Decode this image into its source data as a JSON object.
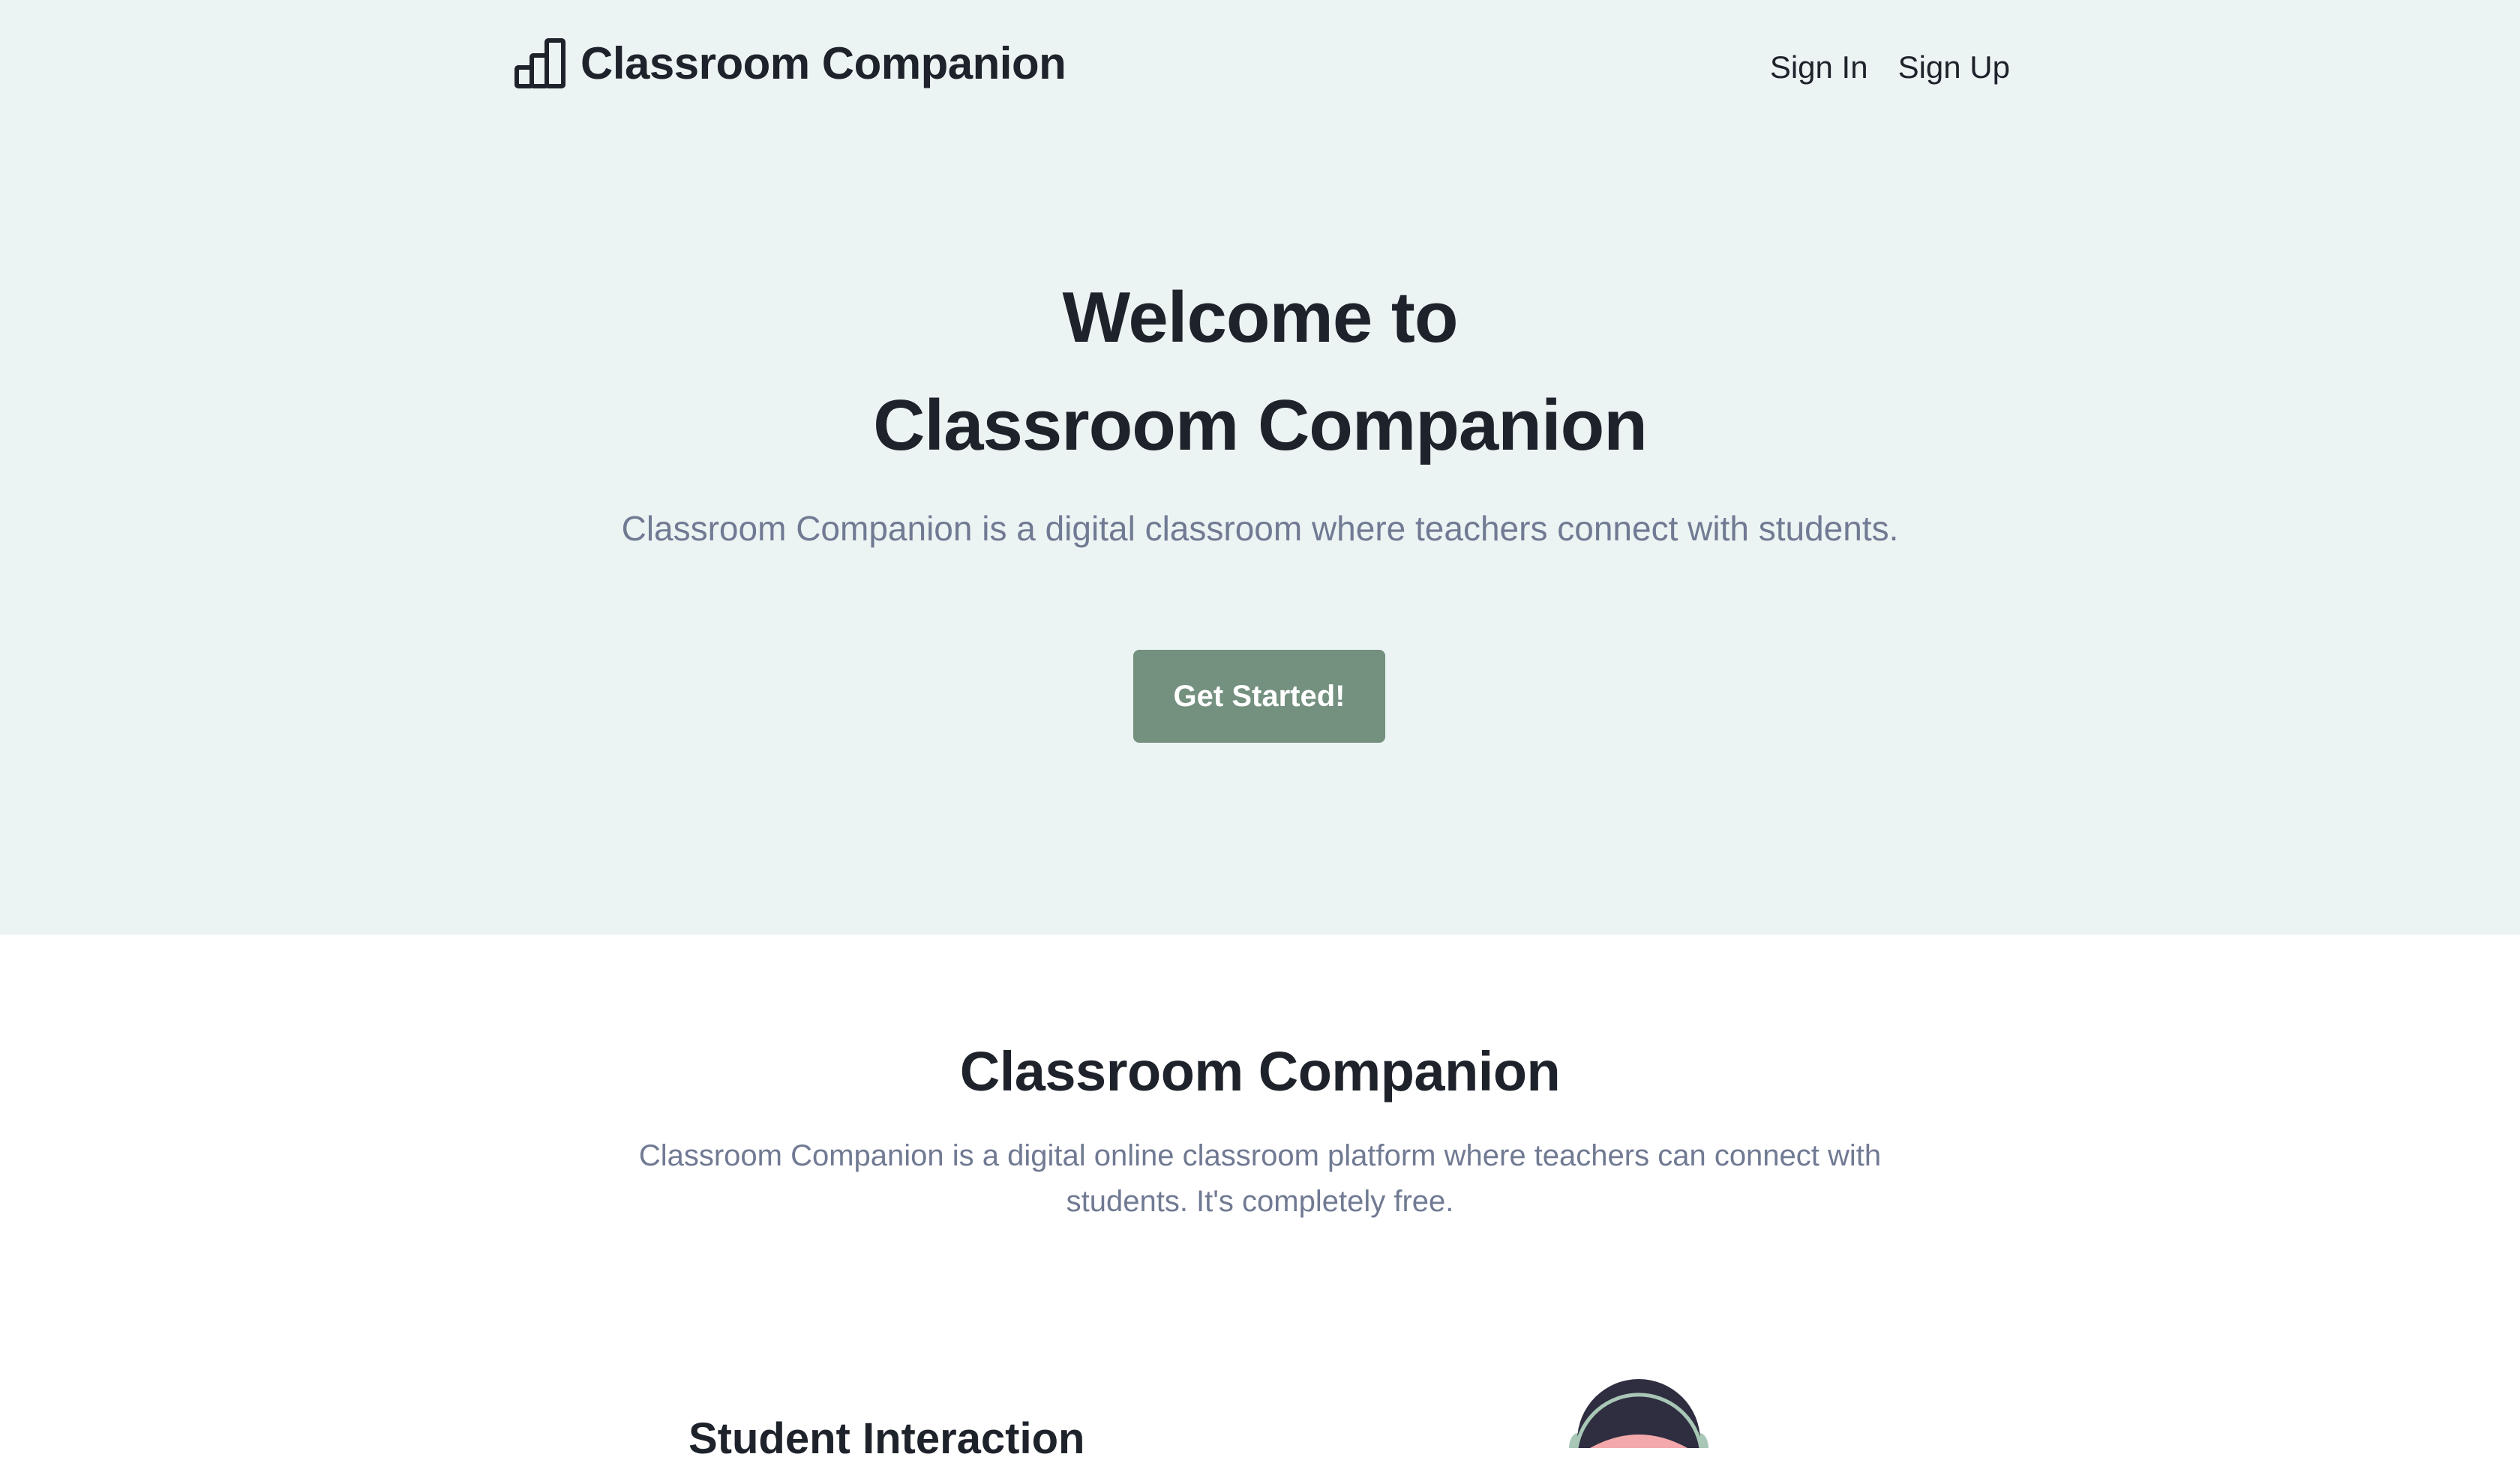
{
  "header": {
    "brand_name": "Classroom Companion",
    "brand_icon": "bar-chart-icon",
    "nav": [
      {
        "label": "Sign In"
      },
      {
        "label": "Sign Up"
      }
    ]
  },
  "hero": {
    "title_line1": "Welcome to",
    "title_line2": "Classroom Companion",
    "subtitle": "Classroom Companion is a digital classroom where teachers connect with students.",
    "cta_label": "Get Started!"
  },
  "about": {
    "title": "Classroom Companion",
    "description": "Classroom Companion is a digital online classroom platform where teachers can connect with students. It's completely free."
  },
  "feature": {
    "title": "Student Interaction",
    "illustration": "student-with-headphones-illustration"
  },
  "colors": {
    "hero_bg": "#ebf4f3",
    "accent": "#74907f",
    "heading": "#1e222b",
    "muted": "#717a93"
  }
}
